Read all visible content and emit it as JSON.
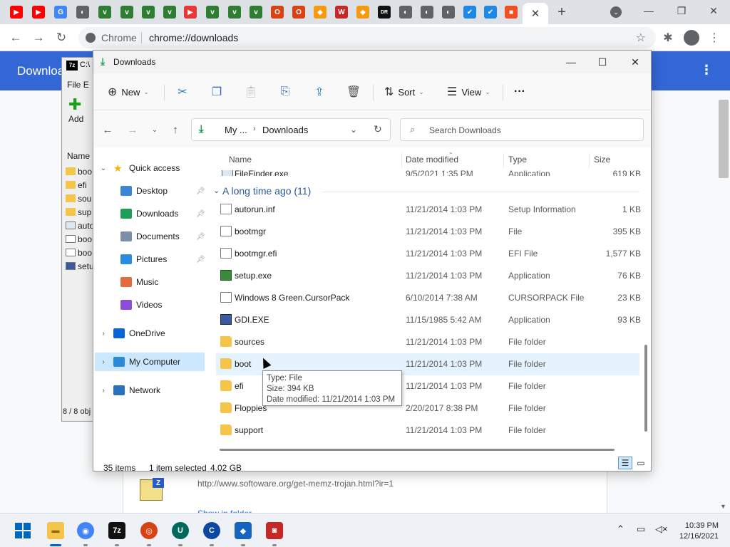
{
  "chrome": {
    "active_tab_close": "✕",
    "new_tab": "+",
    "omnibox_site": "Chrome",
    "omnibox_url": "chrome://downloads",
    "page_title": "Downloa",
    "download_url": "http://www.softoware.org/get-memz-trojan.html?ir=1",
    "download_link": "Show in folder",
    "tab_favicons": [
      {
        "name": "youtube-icon",
        "color": "#ff0000",
        "glyph": "▶"
      },
      {
        "name": "youtube-icon",
        "color": "#ff0000",
        "glyph": "▶"
      },
      {
        "name": "google-icon",
        "color": "#4285f4",
        "glyph": "G"
      },
      {
        "name": "globe-icon",
        "color": "#5f6368",
        "glyph": "◐"
      },
      {
        "name": "green-v-icon",
        "color": "#2e7d32",
        "glyph": "v"
      },
      {
        "name": "green-v-icon",
        "color": "#2e7d32",
        "glyph": "v"
      },
      {
        "name": "green-v-icon",
        "color": "#2e7d32",
        "glyph": "v"
      },
      {
        "name": "green-v-icon",
        "color": "#2e7d32",
        "glyph": "v"
      },
      {
        "name": "red-play-icon",
        "color": "#e53935",
        "glyph": "▶"
      },
      {
        "name": "green-v-icon",
        "color": "#2e7d32",
        "glyph": "v"
      },
      {
        "name": "green-v-icon",
        "color": "#2e7d32",
        "glyph": "v"
      },
      {
        "name": "green-v-icon",
        "color": "#2e7d32",
        "glyph": "v"
      },
      {
        "name": "opera-icon",
        "color": "#d84315",
        "glyph": "O"
      },
      {
        "name": "opera-icon",
        "color": "#d84315",
        "glyph": "O"
      },
      {
        "name": "diamond-icon",
        "color": "#f39c12",
        "glyph": "◆"
      },
      {
        "name": "w-icon",
        "color": "#c62828",
        "glyph": "W"
      },
      {
        "name": "diamond-icon",
        "color": "#f39c12",
        "glyph": "◆"
      },
      {
        "name": "dr-icon",
        "color": "#111111",
        "glyph": "DR"
      },
      {
        "name": "globe-icon",
        "color": "#5f6368",
        "glyph": "◐"
      },
      {
        "name": "globe-icon",
        "color": "#5f6368",
        "glyph": "◐"
      },
      {
        "name": "globe-icon",
        "color": "#5f6368",
        "glyph": "◐"
      },
      {
        "name": "check-icon",
        "color": "#1e88e5",
        "glyph": "✔"
      },
      {
        "name": "check-icon",
        "color": "#1e88e5",
        "glyph": "✔"
      },
      {
        "name": "microsoft-icon",
        "color": "#f25022",
        "glyph": "■"
      }
    ]
  },
  "sevenzip": {
    "title": "C:\\",
    "logo": "7z",
    "menu_file": "File",
    "menu_edit": "E",
    "add_label": "Add",
    "col_name": "Name",
    "rows": [
      {
        "name": "boo",
        "icon": "folder"
      },
      {
        "name": "efi",
        "icon": "folder"
      },
      {
        "name": "sou",
        "icon": "folder"
      },
      {
        "name": "sup",
        "icon": "folder"
      },
      {
        "name": "auto",
        "icon": "setup"
      },
      {
        "name": "boo",
        "icon": "doc"
      },
      {
        "name": "boo",
        "icon": "doc"
      },
      {
        "name": "setu",
        "icon": "exe"
      }
    ],
    "status": "8 / 8 obj"
  },
  "explorer": {
    "title": "Downloads",
    "cmd": {
      "new": "New",
      "sort": "Sort",
      "view": "View",
      "more": "···"
    },
    "address": {
      "my": "My ...",
      "sep": "›",
      "downloads": "Downloads"
    },
    "search_placeholder": "Search Downloads",
    "nav": [
      {
        "label": "Quick access",
        "icon": "star-icon",
        "color": "#f5b400",
        "expand": "⌄",
        "indent": 0,
        "pin": false
      },
      {
        "label": "Desktop",
        "icon": "desktop-icon",
        "color": "#3a86d4",
        "expand": "",
        "indent": 1,
        "pin": true
      },
      {
        "label": "Downloads",
        "icon": "download-icon",
        "color": "#1f9e5a",
        "expand": "",
        "indent": 1,
        "pin": true
      },
      {
        "label": "Documents",
        "icon": "documents-icon",
        "color": "#7a8ea8",
        "expand": "",
        "indent": 1,
        "pin": true
      },
      {
        "label": "Pictures",
        "icon": "pictures-icon",
        "color": "#2b8ae2",
        "expand": "",
        "indent": 1,
        "pin": true
      },
      {
        "label": "Music",
        "icon": "music-icon",
        "color": "#e36b3f",
        "expand": "",
        "indent": 1,
        "pin": false
      },
      {
        "label": "Videos",
        "icon": "videos-icon",
        "color": "#8a4fd6",
        "expand": "",
        "indent": 1,
        "pin": false
      },
      {
        "label": "OneDrive",
        "icon": "onedrive-icon",
        "color": "#0a64d8",
        "expand": "›",
        "indent": 0,
        "pin": false
      },
      {
        "label": "My Computer",
        "icon": "computer-icon",
        "color": "#2a8bd6",
        "expand": "›",
        "indent": 0,
        "pin": false
      },
      {
        "label": "Network",
        "icon": "network-icon",
        "color": "#2a6fc0",
        "expand": "›",
        "indent": 0,
        "pin": false
      }
    ],
    "columns": {
      "name": "Name",
      "date": "Date modified",
      "type": "Type",
      "size": "Size"
    },
    "partial_row": {
      "name": "FileFinder.exe",
      "date": "9/5/2021 1:35 PM",
      "type": "Application",
      "size": "619 KB"
    },
    "group_header": "A long time ago (11)",
    "group_chevron": "⌄",
    "files": [
      {
        "name": "autorun.inf",
        "date": "11/21/2014 1:03 PM",
        "type": "Setup Information",
        "size": "1 KB",
        "icon": "setup"
      },
      {
        "name": "bootmgr",
        "date": "11/21/2014 1:03 PM",
        "type": "File",
        "size": "395 KB",
        "icon": "doc"
      },
      {
        "name": "bootmgr.efi",
        "date": "11/21/2014 1:03 PM",
        "type": "EFI File",
        "size": "1,577 KB",
        "icon": "doc"
      },
      {
        "name": "setup.exe",
        "date": "11/21/2014 1:03 PM",
        "type": "Application",
        "size": "76 KB",
        "icon": "sexe"
      },
      {
        "name": "Windows 8 Green.CursorPack",
        "date": "6/10/2014 7:38 AM",
        "type": "CURSORPACK File",
        "size": "23 KB",
        "icon": "doc"
      },
      {
        "name": "GDI.EXE",
        "date": "11/15/1985 5:42 AM",
        "type": "Application",
        "size": "93 KB",
        "icon": "gdi"
      },
      {
        "name": "sources",
        "date": "11/21/2014 1:03 PM",
        "type": "File folder",
        "size": "",
        "icon": "folder"
      },
      {
        "name": "boot",
        "date": "11/21/2014 1:03 PM",
        "type": "File folder",
        "size": "",
        "icon": "folder"
      },
      {
        "name": "efi",
        "date": "11/21/2014 1:03 PM",
        "type": "File folder",
        "size": "",
        "icon": "folder"
      },
      {
        "name": "Floppies",
        "date": "2/20/2017 8:38 PM",
        "type": "File folder",
        "size": "",
        "icon": "folder"
      },
      {
        "name": "support",
        "date": "11/21/2014 1:03 PM",
        "type": "File folder",
        "size": "",
        "icon": "folder"
      }
    ],
    "tooltip": {
      "type": "Type: File",
      "size": "Size: 394 KB",
      "date": "Date modified: 11/21/2014 1:03 PM"
    },
    "status": {
      "items": "35 items",
      "selected": "1 item selected",
      "selected_size": "4.02 GB"
    }
  },
  "taskbar": {
    "apps": [
      {
        "name": "explorer-app-icon",
        "color": "#f5c54b",
        "glyph": "▬"
      },
      {
        "name": "chrome-app-icon",
        "color": "#4285f4",
        "glyph": "◉"
      },
      {
        "name": "sevenzip-app-icon",
        "color": "#111111",
        "glyph": "7z"
      },
      {
        "name": "opera-app-icon",
        "color": "#d84315",
        "glyph": "◎"
      },
      {
        "name": "u-app-icon",
        "color": "#00695c",
        "glyph": "U"
      },
      {
        "name": "c-app-icon",
        "color": "#0d47a1",
        "glyph": "C"
      },
      {
        "name": "defender-app-icon",
        "color": "#1565c0",
        "glyph": "◆"
      },
      {
        "name": "recorder-app-icon",
        "color": "#c62828",
        "glyph": "◙"
      }
    ],
    "tray_chevron": "⌃",
    "time": "10:39 PM",
    "date": "12/16/2021"
  }
}
